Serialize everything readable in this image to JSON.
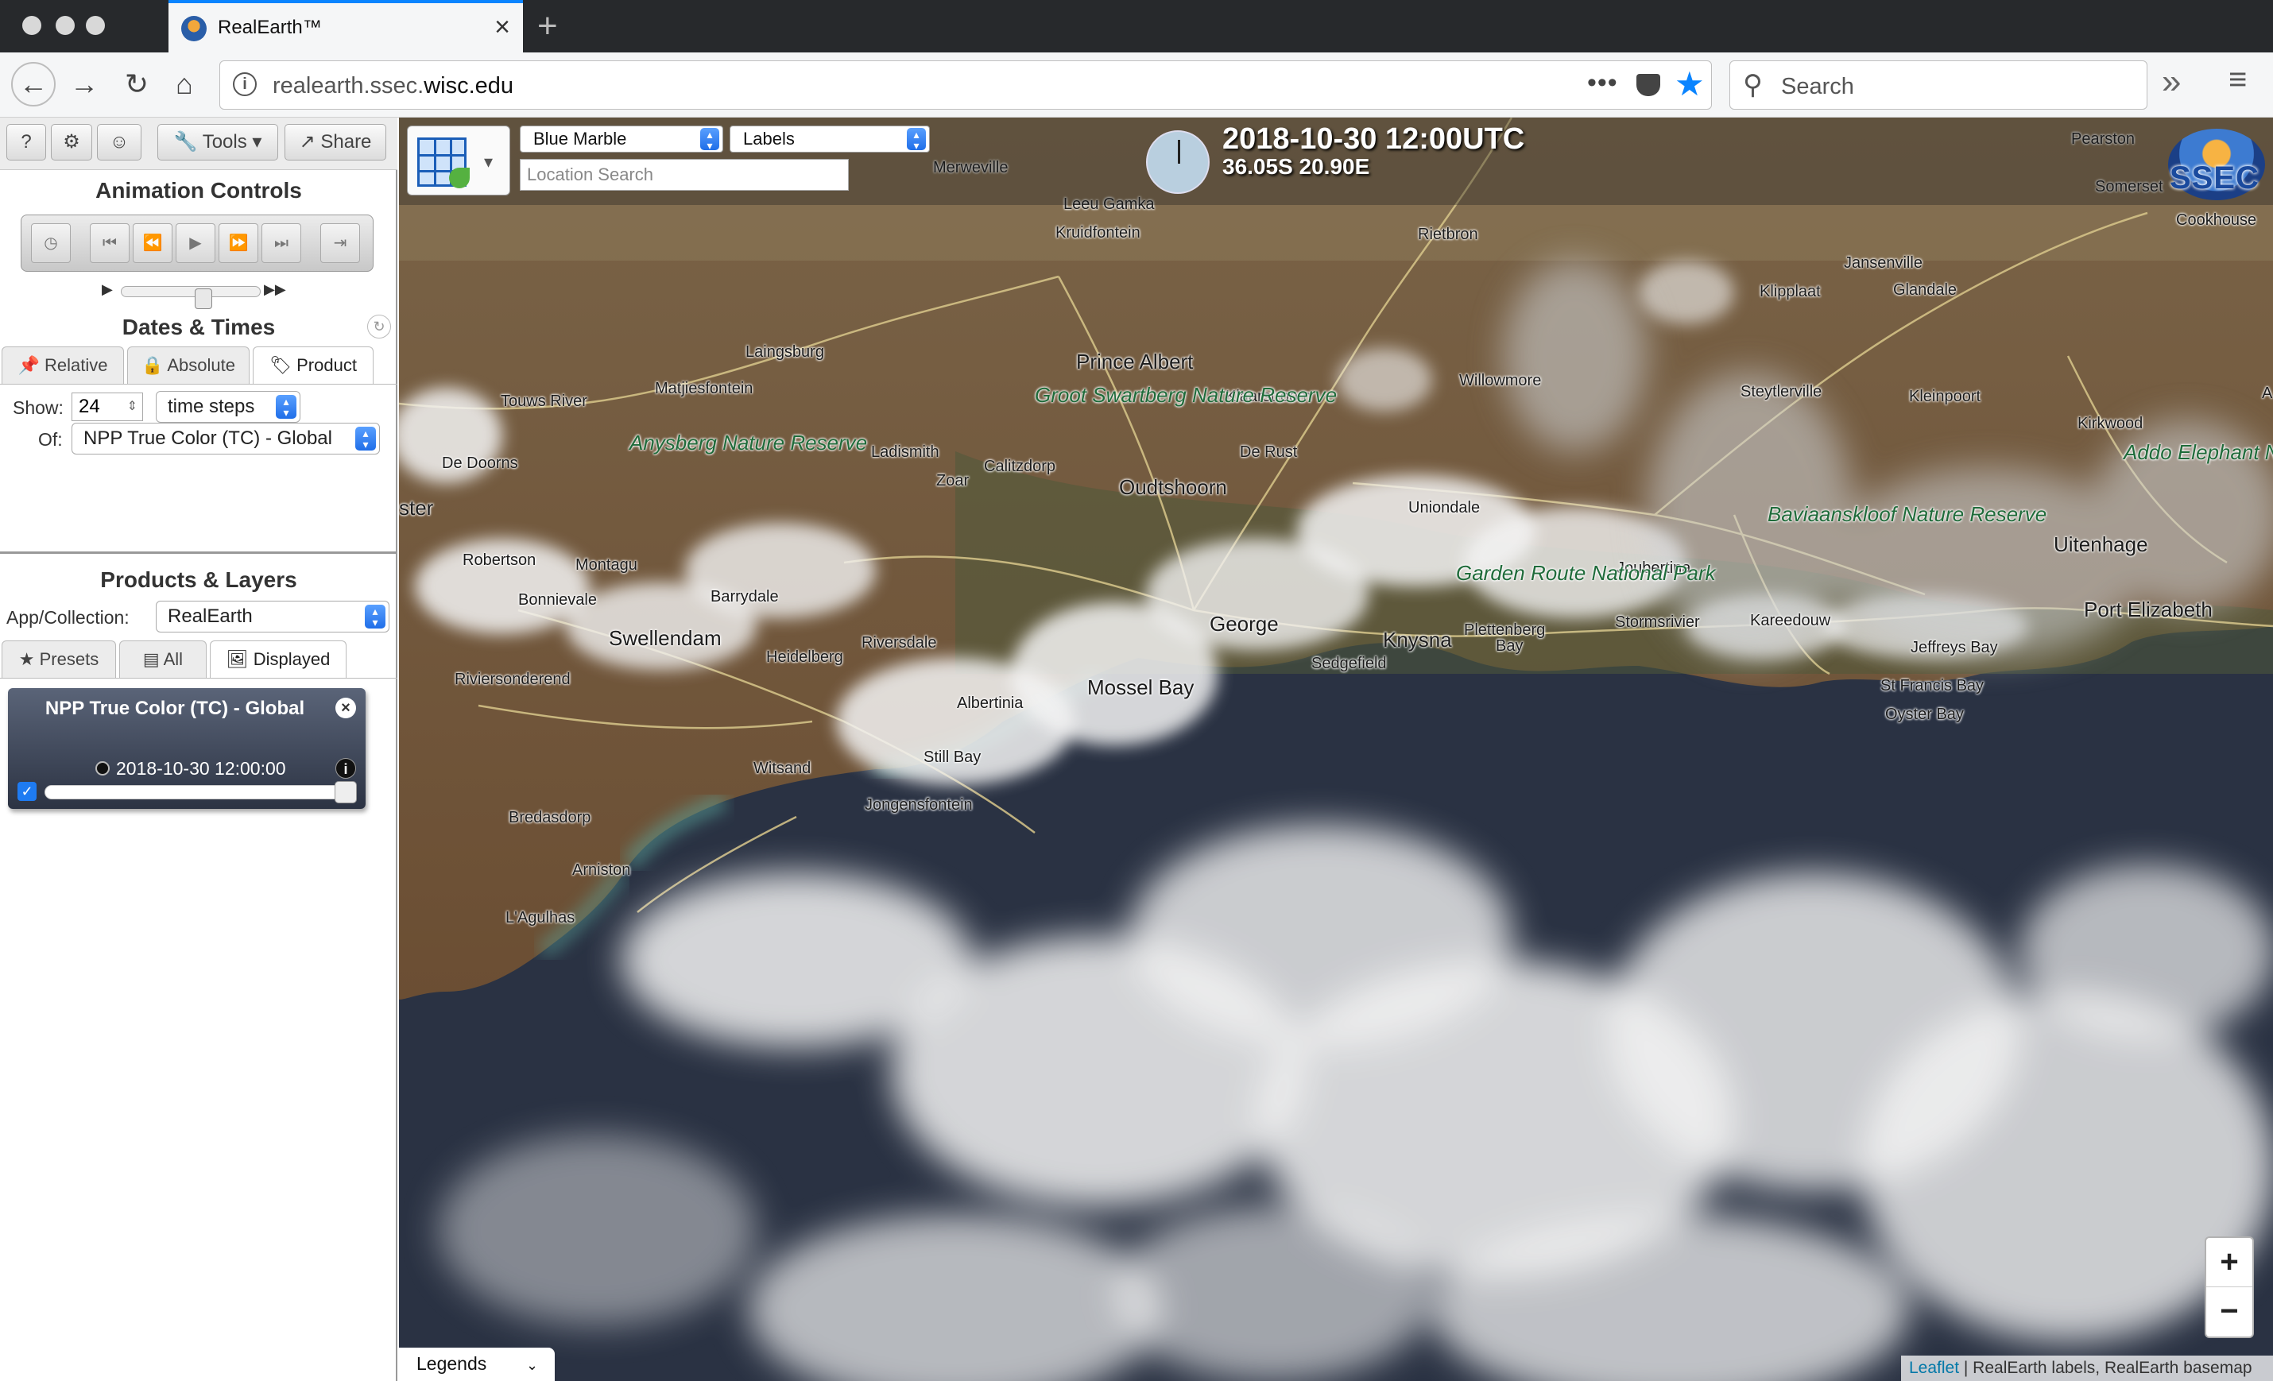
{
  "browser": {
    "tab_title": "RealEarth™",
    "url_prefix": "realearth.ssec.",
    "url_domain": "wisc.edu",
    "search_placeholder": "Search"
  },
  "sidebar": {
    "toolbar": {
      "help": "?",
      "tools": "Tools",
      "share": "Share"
    },
    "animation": {
      "title": "Animation Controls"
    },
    "dates": {
      "title": "Dates & Times",
      "tabs": [
        "Relative",
        "Absolute",
        "Product"
      ],
      "show_label": "Show:",
      "show_value": "24",
      "steps_value": "time steps",
      "of_label": "Of:",
      "of_value": "NPP True Color (TC) - Global"
    },
    "products": {
      "title": "Products & Layers",
      "collection_label": "App/Collection:",
      "collection_value": "RealEarth",
      "tabs": [
        "Presets",
        "All",
        "Displayed"
      ],
      "layer": {
        "name": "NPP True Color (TC) - Global",
        "time": "2018-10-30 12:00:00",
        "opacity": 1.0
      }
    }
  },
  "map": {
    "basemap_select": "Blue Marble",
    "labels_select": "Labels",
    "location_placeholder": "Location Search",
    "datetime": "2018-10-30 12:00UTC",
    "coords": "36.05S 20.90E",
    "logo_text": "SSEC",
    "zoom_in": "+",
    "zoom_out": "−",
    "legends": "Legends",
    "attribution_link": "Leaflet",
    "attribution_text": " | RealEarth labels, RealEarth basemap",
    "places": {
      "merweville": "Merweville",
      "leugamka": "Leeu Gamka",
      "kruidfontein": "Kruidfontein",
      "rietbron": "Rietbron",
      "pearston": "Pearston",
      "somerset": "Somerset",
      "cookhouse": "Cookhouse",
      "jansenville": "Jansenville",
      "klipplaat": "Klipplaat",
      "glandale": "Glandale",
      "laingsburg": "Laingsburg",
      "princealbert": "Prince Albert",
      "touwsriver": "Touws River",
      "matjiesfontein": "Matjiesfontein",
      "klaarstroom": "Klaarstroom",
      "willowmore": "Willowmore",
      "steytlerville": "Steytlerville",
      "kleinpoort": "Kleinpoort",
      "kirkwood": "Kirkwood",
      "dedoorns": "De Doorns",
      "ladismith": "Ladismith",
      "calitzdorp": "Calitzdorp",
      "zoar": "Zoar",
      "oudtshoorn": "Oudtshoorn",
      "derust": "De Rust",
      "uniondale": "Uniondale",
      "uitenhage": "Uitenhage",
      "portelizabeth": "Port Elizabeth",
      "robertson": "Robertson",
      "montagu": "Montagu",
      "bonnievale": "Bonnievale",
      "barrydale": "Barrydale",
      "joubertina": "Joubertina",
      "swellendam": "Swellendam",
      "riversdale": "Riversdale",
      "heidelberg": "Heidelberg",
      "george": "George",
      "knysna": "Knysna",
      "plettenberg": "Plettenberg",
      "bay": "Bay",
      "stormsrivier": "Stormsrivier",
      "kareedouw": "Kareedouw",
      "jeffreysbay": "Jeffreys Bay",
      "sedgefield": "Sedgefield",
      "riviersonderend": "Riviersonderend",
      "albertinia": "Albertinia",
      "mosselbay": "Mossel Bay",
      "stfrancisbay": "St Francis Bay",
      "oysterbay": "Oyster Bay",
      "witsand": "Witsand",
      "stillbay": "Still Bay",
      "jongensfontein": "Jongensfontein",
      "bredasdorp": "Bredasdorp",
      "arniston": "Arniston",
      "lagulhas": "L'Agulhas",
      "ster": "ster",
      "a": "A"
    },
    "reserves": {
      "groot": "Groot Swartberg Nature Reserve",
      "anysberg": "Anysberg Nature Reserve",
      "gardenroute": "Garden Route National Park",
      "baviaans": "Baviaanskloof Nature Reserve",
      "addo": "Addo Elephant National Park"
    }
  }
}
